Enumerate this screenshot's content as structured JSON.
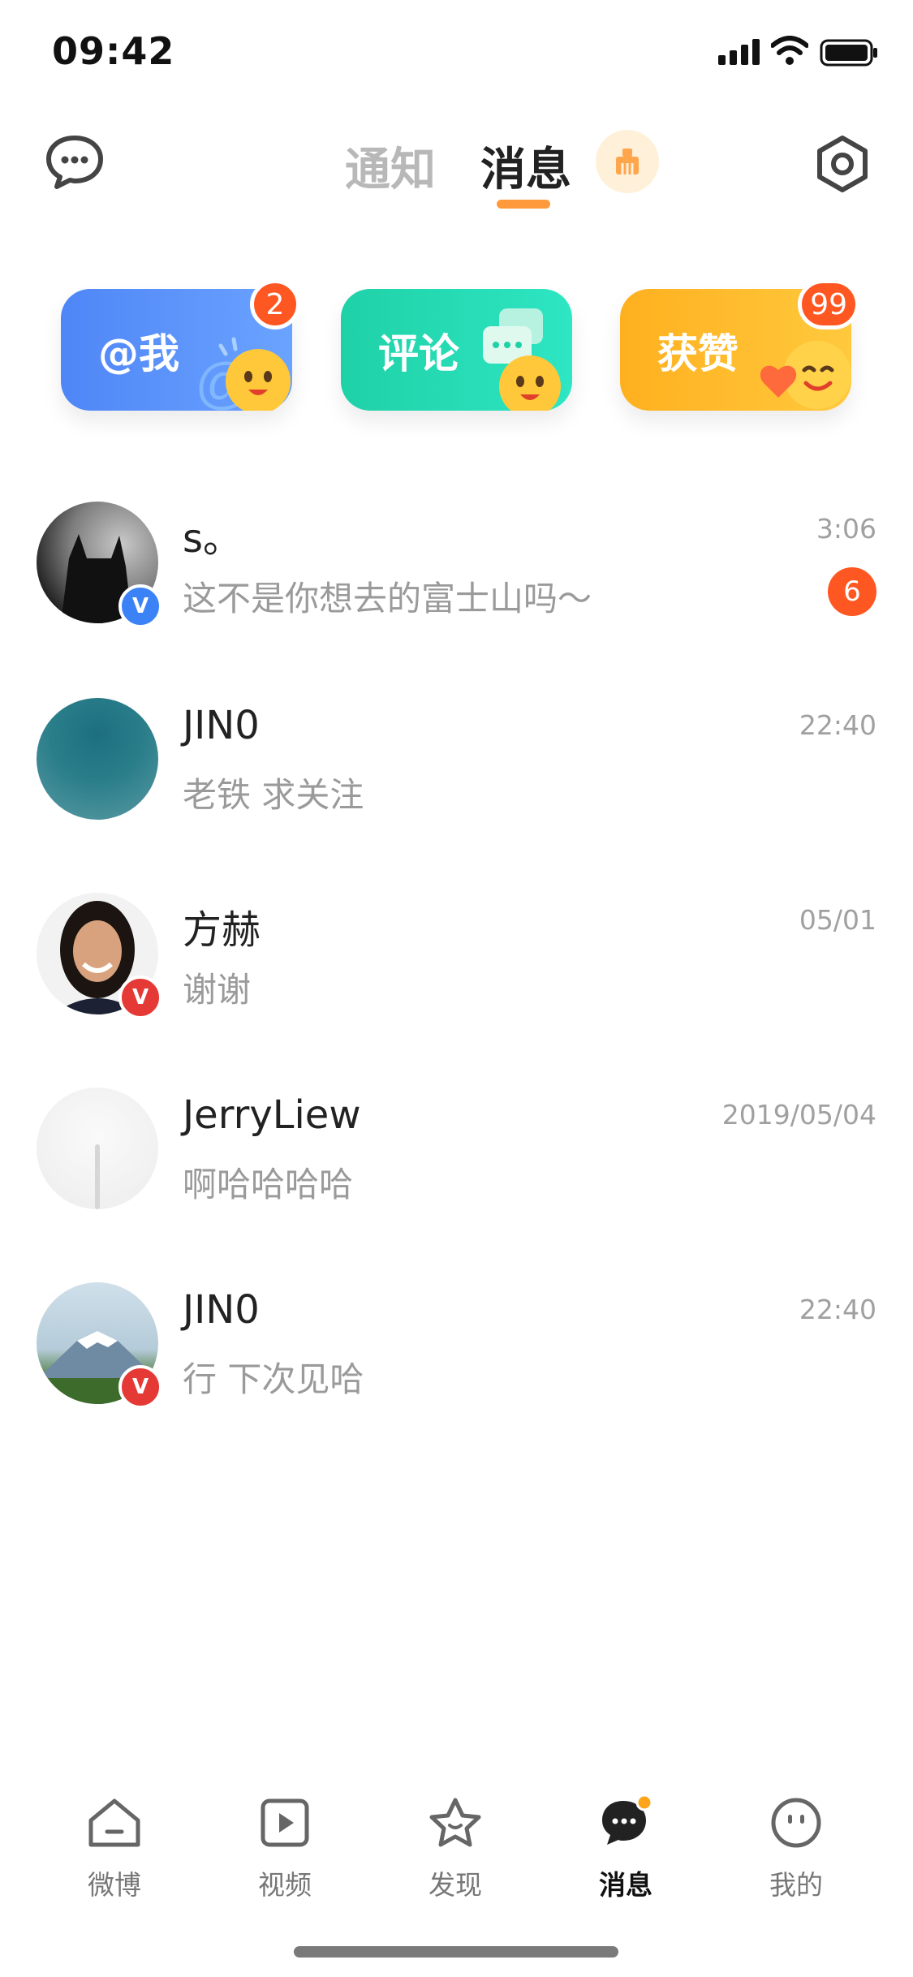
{
  "status_bar": {
    "time": "09:42"
  },
  "header": {
    "tabs": [
      {
        "label": "通知",
        "active": false
      },
      {
        "label": "消息",
        "active": true
      }
    ],
    "accent_color": "#ff9a3c"
  },
  "categories": [
    {
      "label": "@我",
      "badge": "2",
      "color": "#4f86f7"
    },
    {
      "label": "评论",
      "badge": "",
      "color": "#1fd1a7"
    },
    {
      "label": "获赞",
      "badge": "99",
      "color": "#ffb01f"
    }
  ],
  "messages": [
    {
      "name": "s。",
      "preview": "这不是你想去的富士山吗～",
      "time": "3:06",
      "unread": "6",
      "verified": "blue"
    },
    {
      "name": "JIN0",
      "preview": "老铁 求关注",
      "time": "22:40",
      "unread": "",
      "verified": ""
    },
    {
      "name": "方赫",
      "preview": "谢谢",
      "time": "05/01",
      "unread": "",
      "verified": "red"
    },
    {
      "name": "JerryLiew",
      "preview": "啊哈哈哈哈",
      "time": "2019/05/04",
      "unread": "",
      "verified": ""
    },
    {
      "name": "JIN0",
      "preview": "行 下次见哈",
      "time": "22:40",
      "unread": "",
      "verified": "red"
    }
  ],
  "tab_bar": [
    {
      "label": "微博",
      "icon": "home-icon",
      "active": false
    },
    {
      "label": "视频",
      "icon": "video-icon",
      "active": false
    },
    {
      "label": "发现",
      "icon": "star-icon",
      "active": false
    },
    {
      "label": "消息",
      "icon": "message-icon",
      "active": true
    },
    {
      "label": "我的",
      "icon": "profile-icon",
      "active": false
    }
  ]
}
